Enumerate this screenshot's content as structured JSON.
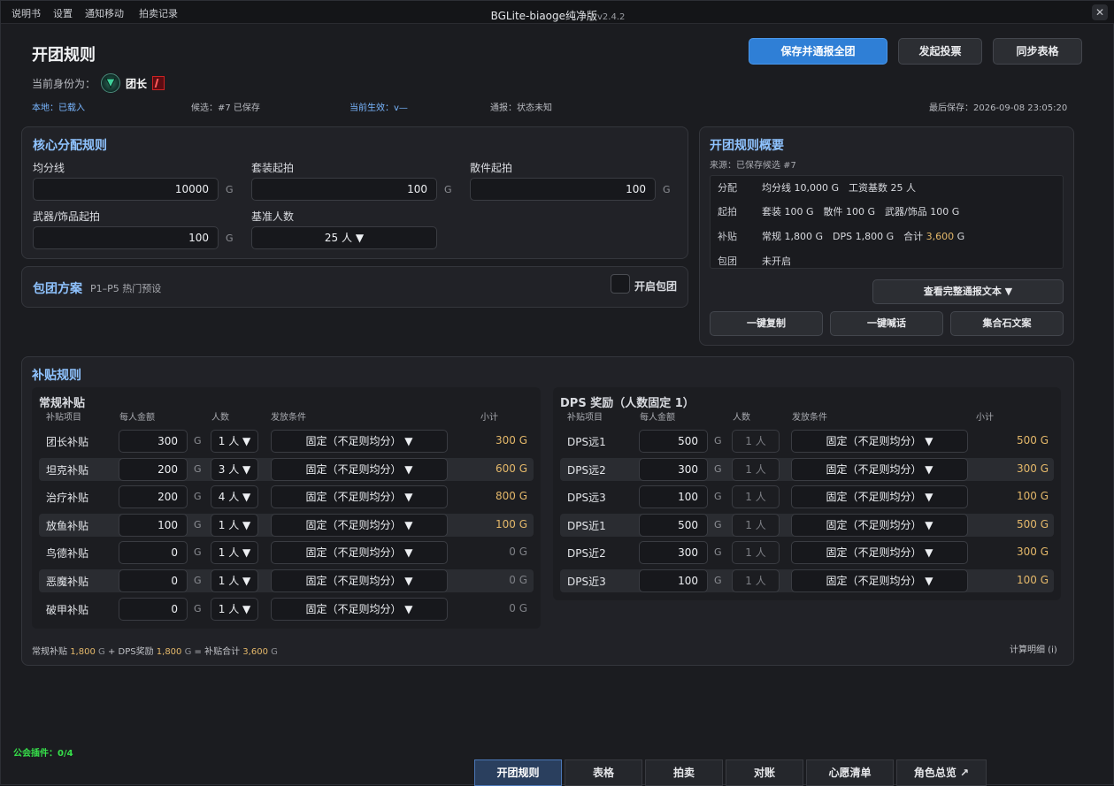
{
  "menu": [
    "说明书",
    "设置",
    "通知移动",
    "拍卖记录"
  ],
  "app": {
    "title": "BGLite-biaoge纯净版",
    "version": "v2.4.2"
  },
  "page_title": "开团规则",
  "role": {
    "label": "当前身份为：",
    "name": "团长"
  },
  "actions": {
    "save": "保存并通报全团",
    "vote": "发起投票",
    "sync": "同步表格"
  },
  "status": {
    "local": "本地：已载入",
    "candidate": "候选：#7 已保存",
    "active": "当前生效：v—",
    "broadcast": "通报：状态未知",
    "last_saved": "最后保存：2026-09-08 23:05:20"
  },
  "core": {
    "title": "核心分配规则",
    "avg_line": {
      "label": "均分线",
      "value": "10000",
      "unit": "G"
    },
    "set_start": {
      "label": "套装起拍",
      "value": "100",
      "unit": "G"
    },
    "piece_start": {
      "label": "散件起拍",
      "value": "100",
      "unit": "G"
    },
    "weapon_start": {
      "label": "武器/饰品起拍",
      "value": "100",
      "unit": "G"
    },
    "base_people": {
      "label": "基准人数",
      "value": "25 人 ▼"
    }
  },
  "package": {
    "title": "包团方案",
    "subtitle": "P1–P5 热门预设",
    "toggle_label": "开启包团"
  },
  "summary": {
    "title": "开团规则概要",
    "source": "来源：已保存候选 #7",
    "rows": [
      {
        "key": "分配",
        "text": "均分线 10,000 G　工资基数 25 人"
      },
      {
        "key": "起拍",
        "text": "套装 100 G　散件 100 G　武器/饰品 100 G"
      },
      {
        "key": "补贴",
        "text_a": "常规 1,800 G　DPS 1,800 G　合计 ",
        "total": "3,600",
        "text_b": " G"
      },
      {
        "key": "包团",
        "text": "未开启"
      }
    ],
    "view_full": "查看完整通报文本 ▼",
    "copy": "一键复制",
    "shout": "一键喊话",
    "gather": "集合石文案"
  },
  "subsidy": {
    "title": "补贴规则",
    "regular": {
      "title": "常规补贴",
      "headers": [
        "补贴项目",
        "每人金额",
        "人数",
        "发放条件",
        "小计"
      ],
      "rows": [
        {
          "name": "团长补贴",
          "amount": "300",
          "unit": "G",
          "count": "1 人 ▼",
          "cond": "固定（不足则均分） ▼",
          "subtotal": "300 G"
        },
        {
          "name": "坦克补贴",
          "amount": "200",
          "unit": "G",
          "count": "3 人 ▼",
          "cond": "固定（不足则均分） ▼",
          "subtotal": "600 G"
        },
        {
          "name": "治疗补贴",
          "amount": "200",
          "unit": "G",
          "count": "4 人 ▼",
          "cond": "固定（不足则均分） ▼",
          "subtotal": "800 G"
        },
        {
          "name": "放鱼补贴",
          "amount": "100",
          "unit": "G",
          "count": "1 人 ▼",
          "cond": "固定（不足则均分） ▼",
          "subtotal": "100 G"
        },
        {
          "name": "鸟德补贴",
          "amount": "0",
          "unit": "G",
          "count": "1 人 ▼",
          "cond": "固定（不足则均分） ▼",
          "subtotal": "0 G"
        },
        {
          "name": "恶魔补贴",
          "amount": "0",
          "unit": "G",
          "count": "1 人 ▼",
          "cond": "固定（不足则均分） ▼",
          "subtotal": "0 G"
        },
        {
          "name": "破甲补贴",
          "amount": "0",
          "unit": "G",
          "count": "1 人 ▼",
          "cond": "固定（不足则均分） ▼",
          "subtotal": "0 G"
        }
      ]
    },
    "dps": {
      "title": "DPS 奖励（人数固定 1）",
      "headers": [
        "补贴项目",
        "每人金额",
        "人数",
        "发放条件",
        "小计"
      ],
      "rows": [
        {
          "name": "DPS远1",
          "amount": "500",
          "unit": "G",
          "count": "1 人",
          "cond": "固定（不足则均分） ▼",
          "subtotal": "500 G"
        },
        {
          "name": "DPS远2",
          "amount": "300",
          "unit": "G",
          "count": "1 人",
          "cond": "固定（不足则均分） ▼",
          "subtotal": "300 G"
        },
        {
          "name": "DPS远3",
          "amount": "100",
          "unit": "G",
          "count": "1 人",
          "cond": "固定（不足则均分） ▼",
          "subtotal": "100 G"
        },
        {
          "name": "DPS近1",
          "amount": "500",
          "unit": "G",
          "count": "1 人",
          "cond": "固定（不足则均分） ▼",
          "subtotal": "500 G"
        },
        {
          "name": "DPS近2",
          "amount": "300",
          "unit": "G",
          "count": "1 人",
          "cond": "固定（不足则均分） ▼",
          "subtotal": "300 G"
        },
        {
          "name": "DPS近3",
          "amount": "100",
          "unit": "G",
          "count": "1 人",
          "cond": "固定（不足则均分） ▼",
          "subtotal": "100 G"
        }
      ]
    },
    "footer": {
      "regular_label": "常规补贴",
      "regular_val": "1,800",
      "dps_label": "DPS奖励",
      "dps_val": "1,800",
      "total_label": "补贴合计",
      "total_val": "3,600",
      "unit": "G",
      "calc": "计算明细 (i)"
    }
  },
  "guild_plugin": "公会插件：0/4",
  "tabs": [
    "开团规则",
    "表格",
    "拍卖",
    "对账",
    "心愿清单",
    "角色总览 ↗"
  ],
  "colors": {
    "accent": "#2f7fd6",
    "gold": "#e4b86a",
    "title_blue": "#8fc3ff",
    "guild_green": "#36e04a"
  }
}
